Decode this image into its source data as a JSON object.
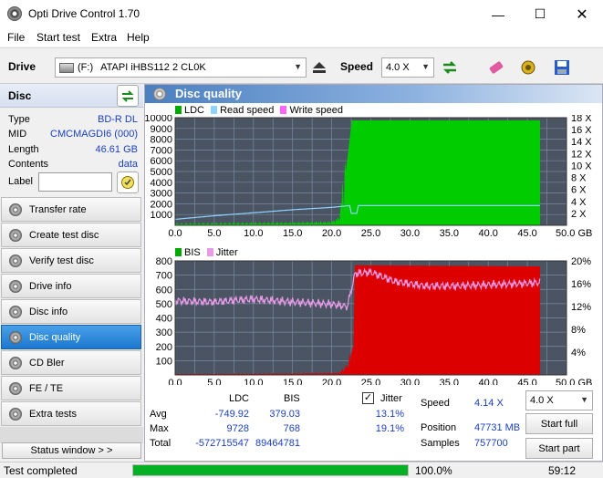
{
  "window": {
    "title": "Opti Drive Control 1.70"
  },
  "menu": [
    "File",
    "Start test",
    "Extra",
    "Help"
  ],
  "drivebar": {
    "drive_label": "Drive",
    "drive_letter": "(F:)",
    "drive_name": "ATAPI iHBS112  2 CL0K",
    "speed_label": "Speed",
    "speed_value": "4.0 X"
  },
  "disc": {
    "header": "Disc",
    "type_label": "Type",
    "type_value": "BD-R DL",
    "mid_label": "MID",
    "mid_value": "CMCMAGDI6 (000)",
    "length_label": "Length",
    "length_value": "46.61 GB",
    "contents_label": "Contents",
    "contents_value": "data",
    "label_label": "Label",
    "label_value": ""
  },
  "nav": [
    {
      "label": "Transfer rate",
      "active": false
    },
    {
      "label": "Create test disc",
      "active": false
    },
    {
      "label": "Verify test disc",
      "active": false
    },
    {
      "label": "Drive info",
      "active": false
    },
    {
      "label": "Disc info",
      "active": false
    },
    {
      "label": "Disc quality",
      "active": true
    },
    {
      "label": "CD Bler",
      "active": false
    },
    {
      "label": "FE / TE",
      "active": false
    },
    {
      "label": "Extra tests",
      "active": false
    }
  ],
  "status_window_label": "Status window > >",
  "panel": {
    "title": "Disc quality"
  },
  "chart_data": [
    {
      "type": "area",
      "legend": [
        "LDC",
        "Read speed",
        "Write speed"
      ],
      "colors": {
        "LDC": "#00cc00",
        "Read speed": "#8fd3ff",
        "Write speed": "#ff66ff"
      },
      "x_ticks": [
        "0.0",
        "5.0",
        "10.0",
        "15.0",
        "20.0",
        "25.0",
        "30.0",
        "35.0",
        "40.0",
        "45.0",
        "50.0 GB"
      ],
      "xlim": [
        0,
        50
      ],
      "y_left_ticks": [
        "1000",
        "2000",
        "3000",
        "4000",
        "5000",
        "6000",
        "7000",
        "8000",
        "9000",
        "10000"
      ],
      "ylim_left": [
        0,
        10000
      ],
      "y_right_ticks": [
        "2 X",
        "4 X",
        "6 X",
        "8 X",
        "10 X",
        "12 X",
        "14 X",
        "16 X",
        "18 X"
      ],
      "ylim_right": [
        0,
        18
      ],
      "ldc_profile": [
        [
          0,
          120
        ],
        [
          5,
          150
        ],
        [
          10,
          180
        ],
        [
          15,
          200
        ],
        [
          20,
          260
        ],
        [
          21,
          600
        ],
        [
          22,
          6000
        ],
        [
          22.6,
          9728
        ],
        [
          46.6,
          9728
        ]
      ],
      "read_speed": [
        [
          0,
          1.0
        ],
        [
          5,
          1.6
        ],
        [
          10,
          2.1
        ],
        [
          15,
          2.6
        ],
        [
          20,
          3.0
        ],
        [
          22.3,
          3.3
        ],
        [
          22.5,
          2.0
        ],
        [
          23.2,
          2.0
        ],
        [
          23.4,
          3.3
        ],
        [
          46.6,
          3.3
        ]
      ]
    },
    {
      "type": "area",
      "legend": [
        "BIS",
        "Jitter"
      ],
      "colors": {
        "BIS": "#dd0000",
        "Jitter": "#e89ae8"
      },
      "x_ticks": [
        "0.0",
        "5.0",
        "10.0",
        "15.0",
        "20.0",
        "25.0",
        "30.0",
        "35.0",
        "40.0",
        "45.0",
        "50.0 GB"
      ],
      "xlim": [
        0,
        50
      ],
      "y_left_ticks": [
        "100",
        "200",
        "300",
        "400",
        "500",
        "600",
        "700",
        "800"
      ],
      "ylim_left": [
        0,
        800
      ],
      "y_right_ticks": [
        "4%",
        "8%",
        "12%",
        "16%",
        "20%"
      ],
      "ylim_right": [
        0,
        20
      ],
      "bis_profile": [
        [
          0,
          5
        ],
        [
          15,
          8
        ],
        [
          21,
          12
        ],
        [
          22,
          60
        ],
        [
          22.8,
          200
        ],
        [
          23.0,
          768
        ],
        [
          46.6,
          760
        ]
      ],
      "jitter": [
        [
          0,
          13.0
        ],
        [
          5,
          12.8
        ],
        [
          10,
          13.3
        ],
        [
          15,
          12.8
        ],
        [
          20,
          12.4
        ],
        [
          22,
          12.0
        ],
        [
          23,
          17.8
        ],
        [
          25,
          18.0
        ],
        [
          28,
          16.4
        ],
        [
          32,
          15.6
        ],
        [
          36,
          15.6
        ],
        [
          40,
          15.8
        ],
        [
          44,
          16.0
        ],
        [
          46.6,
          16.2
        ]
      ]
    }
  ],
  "stats": {
    "ldc_header": "LDC",
    "bis_header": "BIS",
    "jitter_header": "Jitter",
    "avg_label": "Avg",
    "avg_ldc": "-749.92",
    "avg_bis": "379.03",
    "avg_jitter": "13.1%",
    "max_label": "Max",
    "max_ldc": "9728",
    "max_bis": "768",
    "max_jitter": "19.1%",
    "total_label": "Total",
    "total_ldc": "-572715547",
    "total_bis": "89464781",
    "speed_label": "Speed",
    "speed_value": "4.14 X",
    "position_label": "Position",
    "position_value": "47731 MB",
    "samples_label": "Samples",
    "samples_value": "757700",
    "speed_select": "4.0 X",
    "start_full": "Start full",
    "start_part": "Start part"
  },
  "status": {
    "text": "Test completed",
    "progress": 100,
    "progress_label": "100.0%",
    "time": "59:12"
  }
}
